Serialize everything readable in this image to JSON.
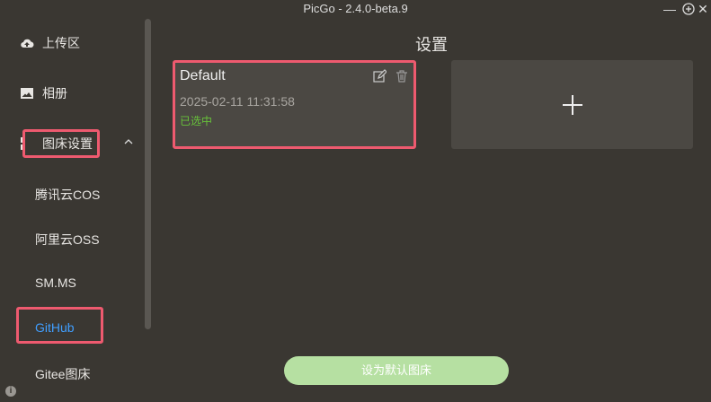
{
  "window": {
    "title": "PicGo - 2.4.0-beta.9"
  },
  "sidebar": {
    "items": [
      {
        "label": "上传区",
        "icon": "upload-cloud-icon"
      },
      {
        "label": "相册",
        "icon": "image-icon"
      },
      {
        "label": "图床设置",
        "icon": "grid-icon"
      }
    ],
    "sub_items": [
      {
        "label": "腾讯云COS"
      },
      {
        "label": "阿里云OSS"
      },
      {
        "label": "SM.MS"
      },
      {
        "label": "GitHub"
      },
      {
        "label": "Gitee图床"
      }
    ]
  },
  "main": {
    "title": "设置",
    "config_card": {
      "name": "Default",
      "date": "2025-02-11 11:31:58",
      "status": "已选中"
    },
    "set_default_label": "设为默认图床"
  },
  "colors": {
    "accent": "#409eff",
    "highlight": "#ee5a6f",
    "selected": "#67c23a",
    "button": "#b6e0a2"
  }
}
